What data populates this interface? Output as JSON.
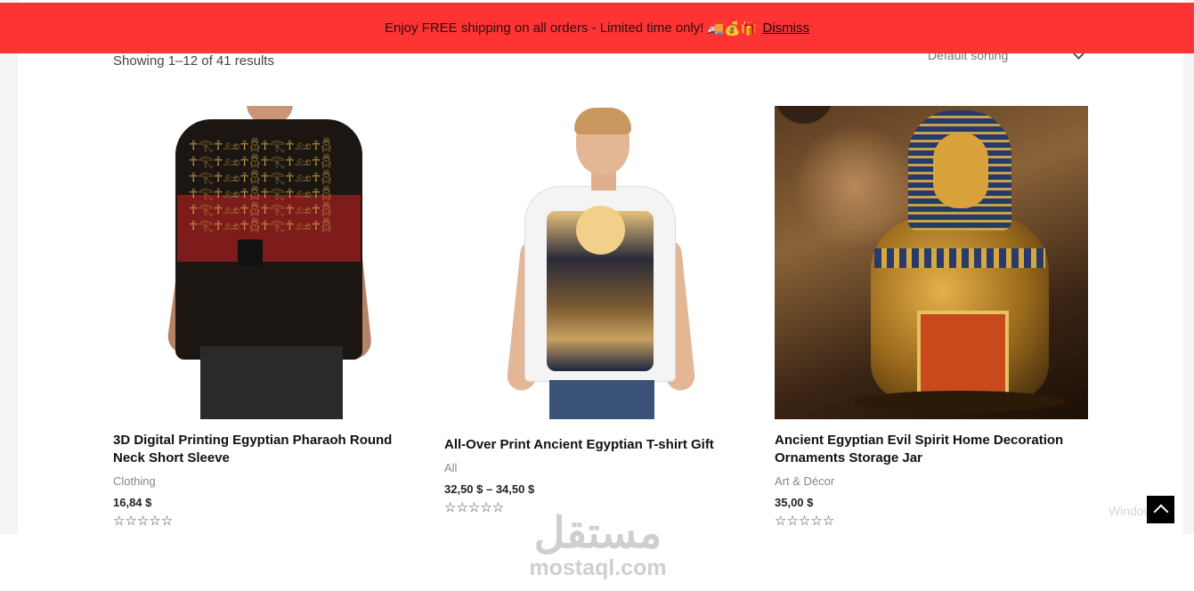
{
  "notice": {
    "text": "Enjoy FREE shipping on all orders - Limited time only!",
    "emoji": "🚚💰🎁",
    "dismiss_label": "Dismiss",
    "bg_color": "#fe3333"
  },
  "shop": {
    "result_count": "Showing 1–12 of 41 results",
    "sorting_selected": "Default sorting"
  },
  "products": [
    {
      "title_line1": "3D Digital Printing Egyptian Pharaoh Round",
      "title_line2": "Neck Short Sleeve",
      "category": "Clothing",
      "price": "16,84 $",
      "rating_stars": "☆☆☆☆☆",
      "rating": 0,
      "image_icon": "man-pharaoh-print-tshirt-image"
    },
    {
      "title_line1": "All-Over Print Ancient Egyptian T-shirt Gift",
      "title_line2": "",
      "category": "All",
      "price": "32,50 $ – 34,50 $",
      "rating_stars": "☆☆☆☆☆",
      "rating": 0,
      "image_icon": "man-white-pharaoh-tshirt-image"
    },
    {
      "title_line1": "Ancient Egyptian Evil Spirit Home Decoration",
      "title_line2": "Ornaments Storage Jar",
      "category": "Art & Décor",
      "price": "35,00 $",
      "rating_stars": "☆☆☆☆☆",
      "rating": 0,
      "image_icon": "golden-canopic-jar-image"
    }
  ],
  "overlay": {
    "windows_text": "Windows",
    "watermark_ar": "مستقل",
    "watermark_lat": "mostaql.com"
  }
}
